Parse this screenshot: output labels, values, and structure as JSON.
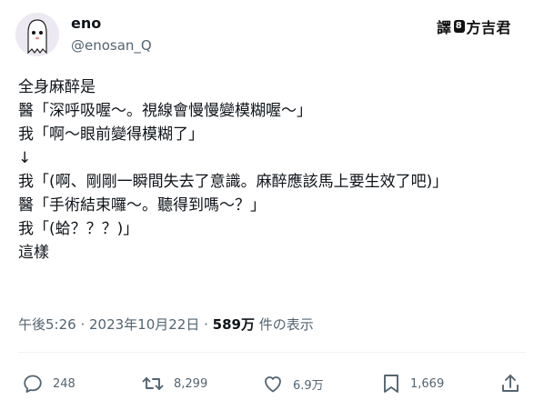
{
  "author": {
    "name": "eno",
    "handle": "@enosan_Q",
    "avatar_icon": "white-ghost-character-avatar"
  },
  "badge": {
    "left": "譯",
    "mid": "8",
    "right": "方吉君"
  },
  "post": {
    "lines": [
      "全身麻醉是",
      "醫「深呼吸喔～。視線會慢慢變模糊喔～」",
      "我「啊～眼前變得模糊了」",
      "↓",
      "我「(啊、剛剛一瞬間失去了意識。麻醉應該馬上要生效了吧)」",
      "醫「手術結束囉～。聽得到嗎～？」",
      "我「(蛤？？？)」",
      "這樣"
    ]
  },
  "meta": {
    "time": "午後5:26",
    "sep": " · ",
    "date": "2023年10月22日",
    "views": "589万",
    "views_label": " 件の表示"
  },
  "actions": {
    "replies": "248",
    "reposts": "8,299",
    "likes": "6.9万",
    "bookmarks": "1,669"
  },
  "colors": {
    "text": "#0f1419",
    "secondary": "#536471",
    "divider": "#eff3f4"
  }
}
